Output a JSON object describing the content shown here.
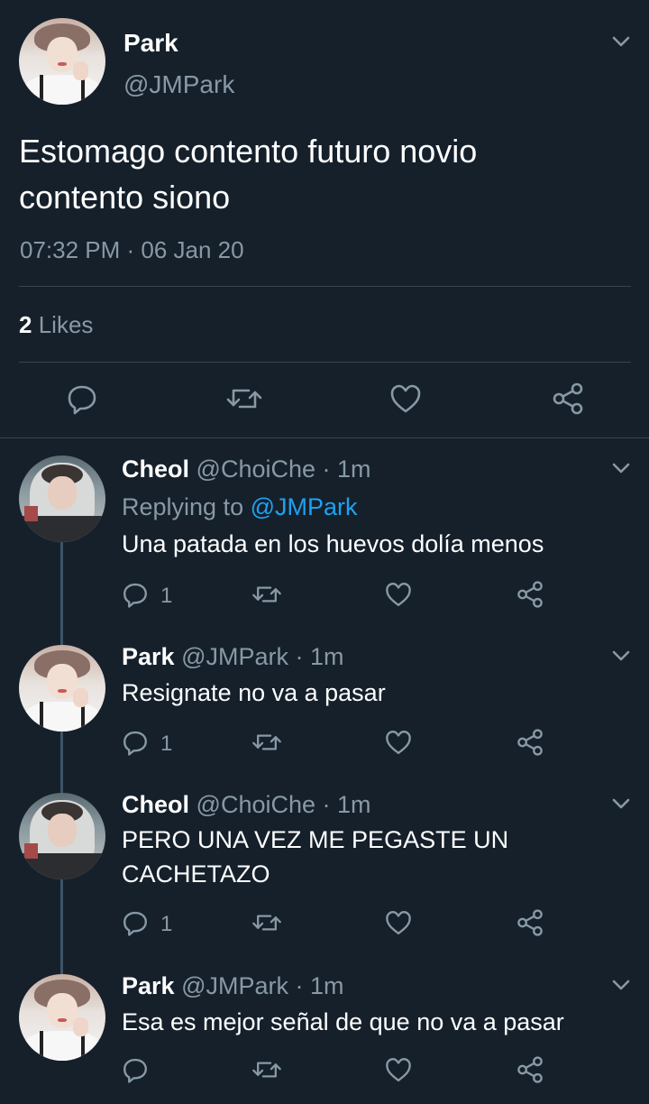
{
  "main_tweet": {
    "author_name": "Park",
    "author_handle": "@JMPark",
    "text_line1": "Estomago contento futuro novio",
    "text_line2": "contento siono",
    "timestamp": "07:32 PM · 06 Jan 20",
    "likes_count": "2",
    "likes_label": "Likes"
  },
  "replies": [
    {
      "name": "Cheol",
      "handle": "@ChoiChe · 1m",
      "replying_prefix": "Replying to",
      "replying_to": "@JMPark",
      "text_lines": [
        "Una patada en los huevos dolía menos"
      ],
      "reply_count": "1"
    },
    {
      "name": "Park",
      "handle": "@JMPark · 1m",
      "text_lines": [
        "Resignate no va a pasar"
      ],
      "reply_count": "1"
    },
    {
      "name": "Cheol",
      "handle": "@ChoiChe · 1m",
      "text_lines": [
        "PERO UNA VEZ ME PEGASTE UN",
        "CACHETAZO"
      ],
      "reply_count": "1"
    },
    {
      "name": "Park",
      "handle": "@JMPark · 1m",
      "text_lines": [
        "Esa es mejor señal de que no va a pasar"
      ],
      "reply_count": ""
    }
  ],
  "icons": {
    "reply": "reply-icon",
    "retweet": "retweet-icon",
    "like": "like-icon",
    "share": "share-icon",
    "more": "chevron-down-icon"
  },
  "colors": {
    "background": "#15202b",
    "secondary_text": "#8899a6",
    "link": "#1da1f2",
    "divider": "#38444d"
  }
}
